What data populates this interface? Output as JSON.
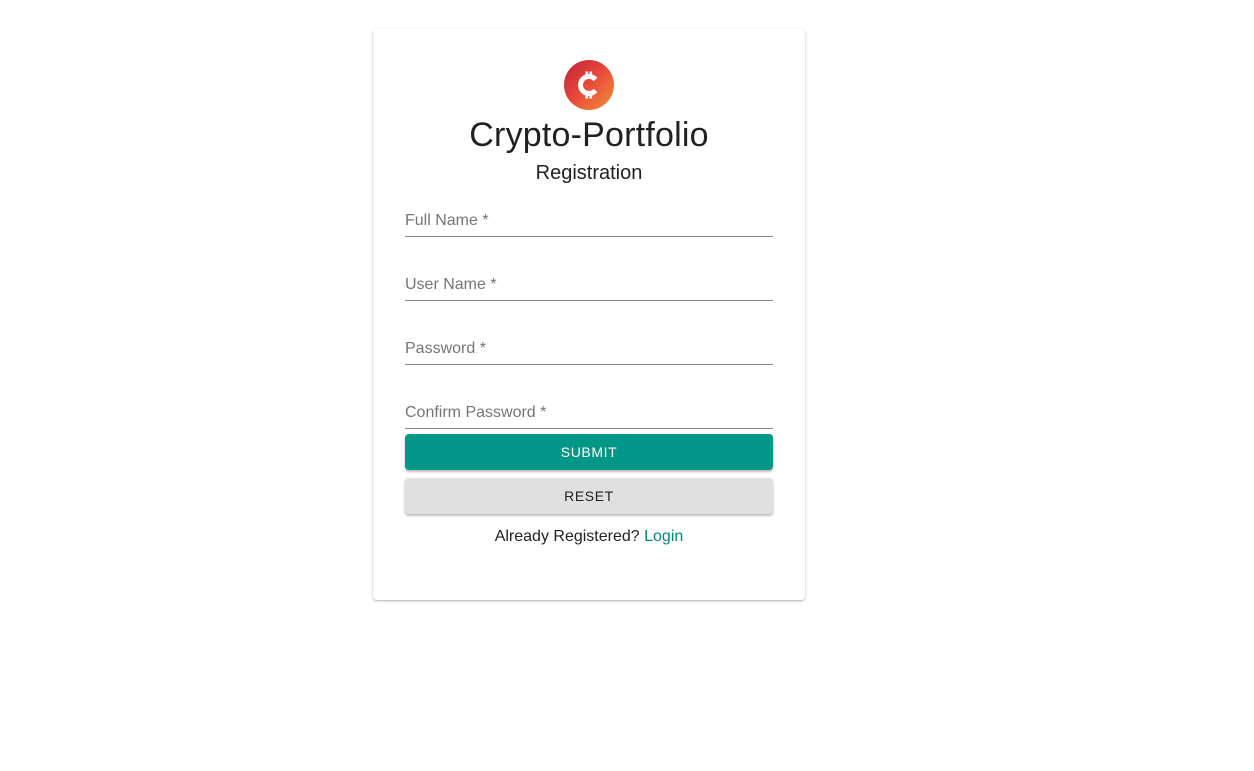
{
  "app": {
    "title": "Crypto-Portfolio",
    "subtitle": "Registration",
    "logo_icon": "bitcoin-c-logo-icon",
    "accent_color": "#009688"
  },
  "form": {
    "fields": [
      {
        "label": "Full Name *",
        "value": ""
      },
      {
        "label": "User Name *",
        "value": ""
      },
      {
        "label": "Password *",
        "value": ""
      },
      {
        "label": "Confirm Password *",
        "value": ""
      }
    ],
    "submit_label": "SUBMIT",
    "reset_label": "RESET"
  },
  "footer": {
    "prompt": "Already Registered?",
    "login_label": "Login"
  }
}
